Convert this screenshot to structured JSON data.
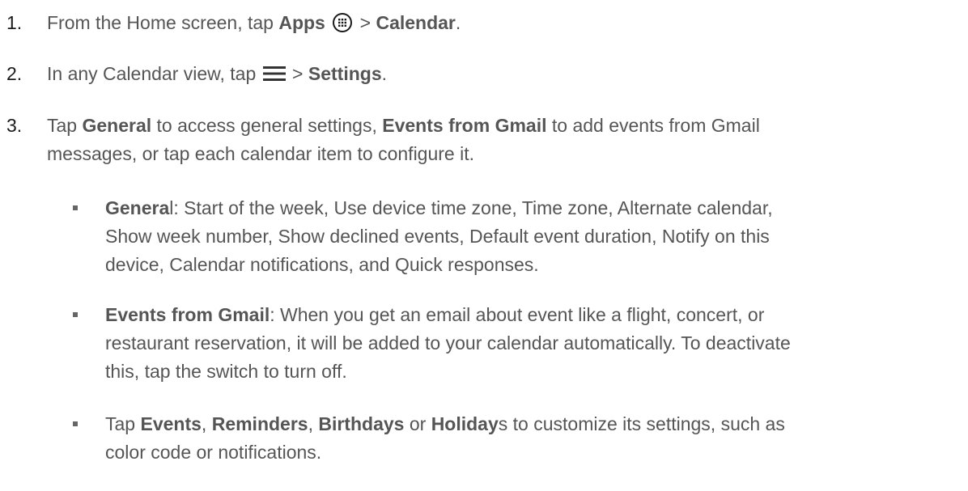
{
  "steps": [
    {
      "number": "1.",
      "prefix": "From the Home screen, tap ",
      "apps_label": "Apps",
      "apps_icon": "apps-grid-icon",
      "separator": " > ",
      "calendar_label": "Calendar",
      "suffix": "."
    },
    {
      "number": "2.",
      "prefix": "In any Calendar view, tap ",
      "menu_icon": "hamburger-menu-icon",
      "separator": " > ",
      "settings_label": "Settings",
      "suffix": "."
    },
    {
      "number": "3.",
      "prefix": "Tap ",
      "general_label": "General",
      "mid1": " to access general settings, ",
      "events_gmail_label": "Events from Gmail",
      "line1_end": " to add events from Gmail",
      "line2": "messages, or tap each calendar item to configure it."
    }
  ],
  "bullets": [
    {
      "bold_part": "Genera",
      "plain_part": "l: Start of the week, Use device time zone, Time zone, Alternate calendar,",
      "line2": "Show week number, Show declined events, Default event duration, Notify on this",
      "line3": "device, Calendar notifications, and Quick responses."
    },
    {
      "bold_part": "Events from Gmail",
      "plain_part": ": When you get an email about event like a flight, concert, or",
      "line2": "restaurant reservation, it will be added to your calendar automatically. To deactivate",
      "line3": "this, tap the switch to turn off."
    },
    {
      "prefix": "Tap ",
      "events_label": "Events",
      "sep1": ", ",
      "reminders_label": "Reminders",
      "sep2": ", ",
      "birthdays_label": "Birthdays",
      "sep3": " or ",
      "holiday_label": "Holiday",
      "line1_end": "s to customize its settings, such as",
      "line2": "color code or notifications."
    }
  ]
}
